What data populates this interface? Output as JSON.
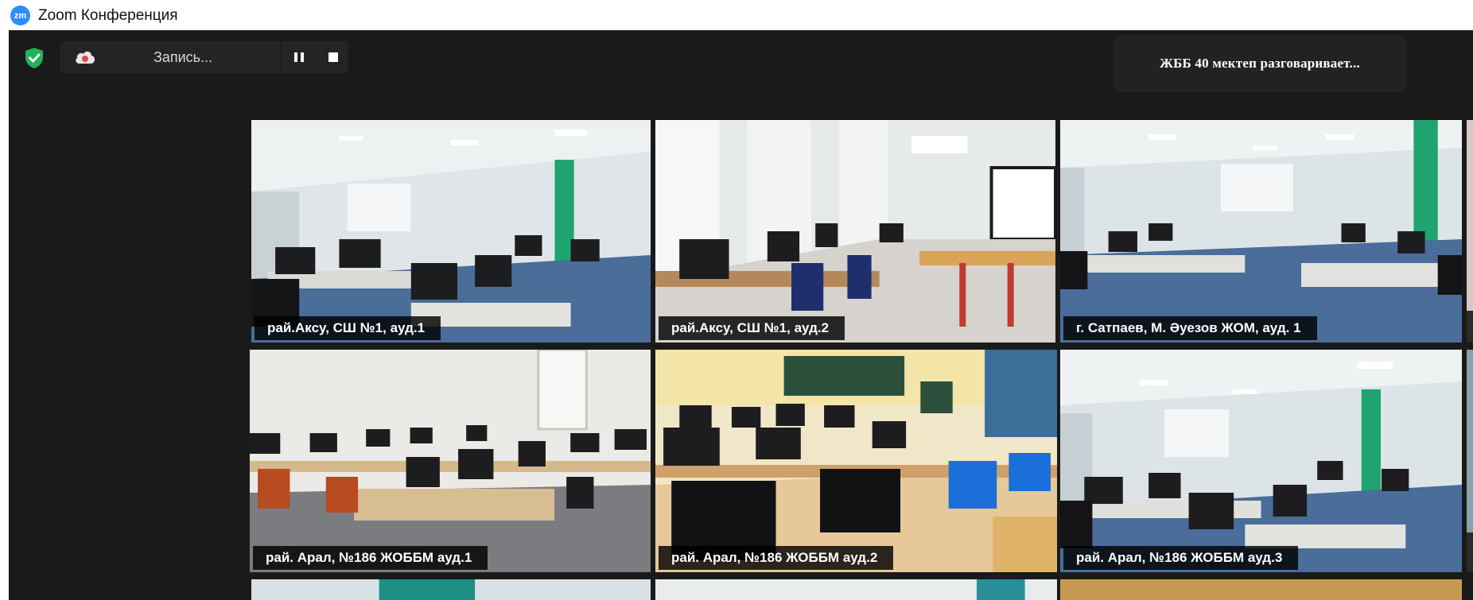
{
  "window": {
    "logo_text": "zm",
    "title": "Zoom Конференция"
  },
  "recording": {
    "label": "Запись..."
  },
  "speaker": {
    "text": "ЖББ 40 мектеп разговаривает..."
  },
  "tiles": [
    {
      "label": "рай.Аксу, СШ №1, ауд.1"
    },
    {
      "label": "рай.Аксу, СШ №1, ауд.2"
    },
    {
      "label": "г. Сатпаев, М. Әуезов ЖОМ,  ауд. 1"
    },
    {
      "label": "рай. Арал, №186 ЖОББМ ауд.1"
    },
    {
      "label": "рай. Арал, №186 ЖОББМ ауд.2"
    },
    {
      "label": "рай. Арал, №186 ЖОББМ ауд.3"
    }
  ],
  "colors": {
    "stage_bg": "#1a1a1a",
    "zoom_blue": "#2d8cff",
    "shield_green": "#21b35c",
    "classroom_green": "#1fa36f"
  },
  "icons": [
    "zoom-logo",
    "shield-check-icon",
    "cloud-record-icon",
    "pause-icon",
    "stop-icon"
  ]
}
